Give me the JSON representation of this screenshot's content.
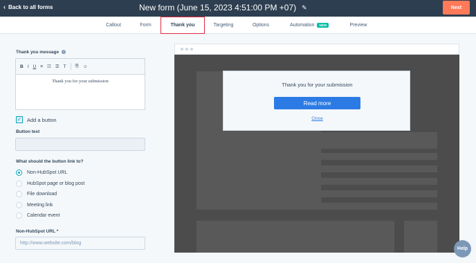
{
  "header": {
    "back_label": "Back to all forms",
    "title": "New form (June 15, 2023 4:51:00 PM +07)",
    "next_label": "Next"
  },
  "tabs": [
    {
      "label": "Callout"
    },
    {
      "label": "Form"
    },
    {
      "label": "Thank you",
      "active": true
    },
    {
      "label": "Targeting"
    },
    {
      "label": "Options"
    },
    {
      "label": "Automation",
      "badge": "NEW"
    },
    {
      "label": "Preview"
    }
  ],
  "left": {
    "thank_you_label": "Thank you message",
    "editor_text": "Thank you for your submission",
    "toolbar": [
      "B",
      "I",
      "U",
      "≡",
      "☷",
      "☰",
      "T",
      "⎘",
      "☺"
    ],
    "add_button_label": "Add a button",
    "add_button_checked": true,
    "button_text_label": "Button text",
    "button_text_value": "",
    "link_question": "What should the button link to?",
    "link_options": [
      {
        "label": "Non-HubSpot URL",
        "selected": true
      },
      {
        "label": "HubSpot page or blog post",
        "selected": false
      },
      {
        "label": "File download",
        "selected": false
      },
      {
        "label": "Meeting link",
        "selected": false
      },
      {
        "label": "Calendar event",
        "selected": false
      }
    ],
    "url_label": "Non-HubSpot URL *",
    "url_placeholder": "http://www.website.com/blog"
  },
  "preview": {
    "message": "Thank you for your submission",
    "button_label": "Read more",
    "close_label": "Close"
  },
  "help_label": "Help",
  "colors": {
    "header_bg": "#2d3e50",
    "accent": "#ff7a59",
    "primary_button": "#2c7be5",
    "badge": "#00bda5",
    "active_tab_outline": "#e0283c"
  }
}
